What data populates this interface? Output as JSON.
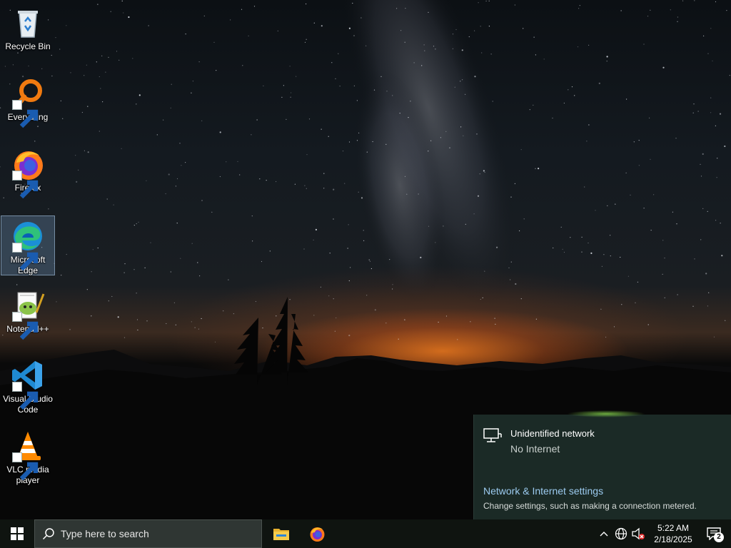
{
  "desktop": {
    "icons": [
      {
        "label": "Recycle Bin",
        "icon": "recycle-bin-icon",
        "shortcut": false,
        "selected": false
      },
      {
        "label": "Everything",
        "icon": "everything-search-icon",
        "shortcut": true,
        "selected": false
      },
      {
        "label": "Firefox",
        "icon": "firefox-icon",
        "shortcut": true,
        "selected": false
      },
      {
        "label": "Microsoft Edge",
        "icon": "edge-icon",
        "shortcut": true,
        "selected": true
      },
      {
        "label": "Notepad++",
        "icon": "notepad-plus-plus-icon",
        "shortcut": true,
        "selected": false
      },
      {
        "label": "Visual Studio Code",
        "icon": "vscode-icon",
        "shortcut": true,
        "selected": false
      },
      {
        "label": "VLC media player",
        "icon": "vlc-icon",
        "shortcut": true,
        "selected": false
      }
    ]
  },
  "network_flyout": {
    "network_name": "Unidentified network",
    "status": "No Internet",
    "settings_link": "Network & Internet settings",
    "settings_description": "Change settings, such as making a connection metered.",
    "icon": "network-pc-icon"
  },
  "taskbar": {
    "start_icon": "windows-start-icon",
    "search_placeholder": "Type here to search",
    "pinned": [
      {
        "name": "File Explorer",
        "icon": "file-explorer-icon"
      },
      {
        "name": "Firefox",
        "icon": "firefox-icon"
      }
    ],
    "tray": {
      "overflow_icon": "chevron-up-icon",
      "network_icon": "globe-network-icon",
      "volume_icon": "speaker-muted-icon",
      "time": "5:22 AM",
      "date": "2/18/2025",
      "notification_count": "2"
    }
  },
  "colors": {
    "taskbar_bg": "#0f1410",
    "flyout_bg": "#1c2c28",
    "link": "#9ccbf0",
    "selection": "#7aa0c8"
  }
}
